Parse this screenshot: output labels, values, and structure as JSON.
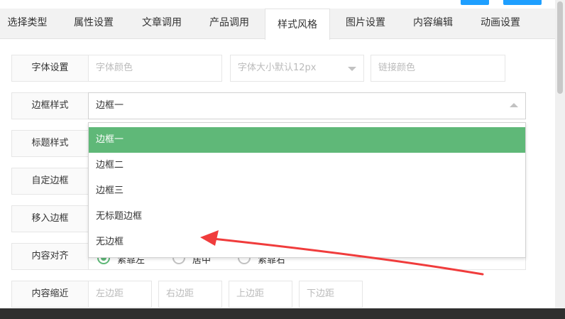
{
  "tabs": [
    {
      "label": "选择类型"
    },
    {
      "label": "属性设置"
    },
    {
      "label": "文章调用"
    },
    {
      "label": "产品调用"
    },
    {
      "label": "样式风格"
    },
    {
      "label": "图片设置"
    },
    {
      "label": "内容编辑"
    },
    {
      "label": "动画设置"
    }
  ],
  "active_tab": "样式风格",
  "font_settings": {
    "label": "字体设置",
    "font_color_placeholder": "字体颜色",
    "font_size_placeholder": "字体大小默认12px",
    "link_color_placeholder": "链接颜色"
  },
  "border_style": {
    "label": "边框样式",
    "value": "边框一",
    "options": [
      "边框一",
      "边框二",
      "边框三",
      "无标题边框",
      "无边框"
    ],
    "selected_index": 0
  },
  "rows": {
    "title_style": "标题样式",
    "custom_border": "自定边框",
    "hover_border": "移入边框",
    "content_align": "内容对齐",
    "content_indent": "内容缩近"
  },
  "content_align": {
    "options": [
      "紧靠左",
      "居中",
      "紧靠右"
    ],
    "selected_index": 0
  },
  "indent": {
    "left_placeholder": "左边距",
    "right_placeholder": "右边距",
    "top_placeholder": "上边距",
    "bottom_placeholder": "下边距"
  },
  "colors": {
    "accent_green": "#5fb878",
    "annotation_red": "#f03c3c",
    "top_button_blue": "#1e9fff"
  }
}
